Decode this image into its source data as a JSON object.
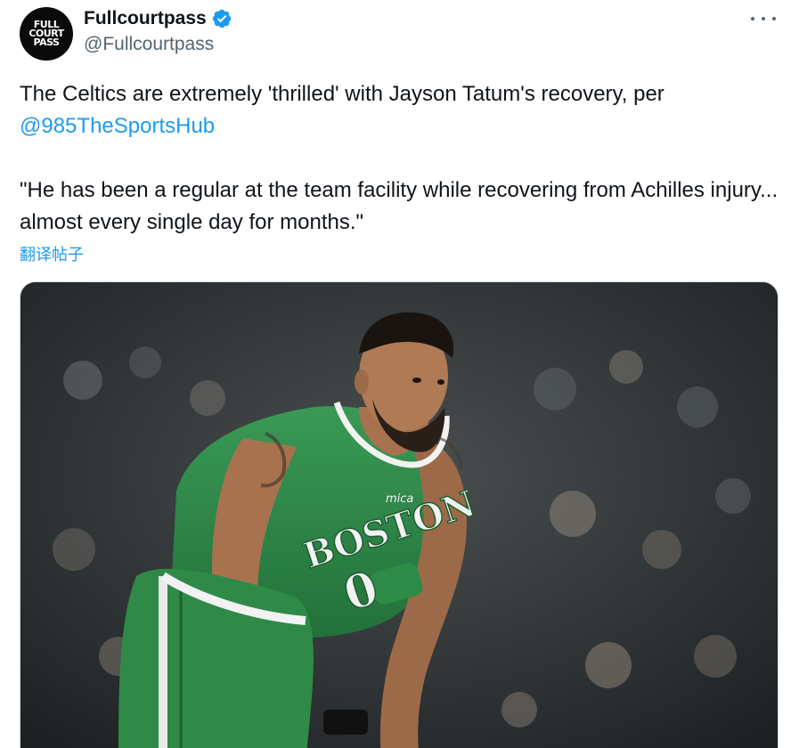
{
  "author": {
    "display_name": "Fullcourtpass",
    "handle": "@Fullcourtpass",
    "verified": true,
    "avatar_icon": "fullcourtpass-logo-icon",
    "avatar_logo_text": [
      "FULL",
      "COURT",
      "PASS"
    ]
  },
  "menu": {
    "icon": "more-horizontal-icon"
  },
  "tweet": {
    "line1_text": "The Celtics are extremely 'thrilled' with Jayson Tatum's recovery, per",
    "mention": "@985TheSportsHub",
    "line3_text": "\"He has been a regular at the team facility while recovering from Achilles injury... almost every single day for months.\"",
    "translate_label": "翻译帖子"
  },
  "media": {
    "type": "photo",
    "jersey_text": "BOSTON",
    "jersey_number": "0",
    "jersey_sponsor": "mica",
    "colors": {
      "jersey": "#2e8b47",
      "jersey_trim": "#f2f2f2",
      "skin": "#b07a55",
      "crowd_bg": "#2b3033"
    }
  },
  "colors": {
    "accent": "#1d9bf0",
    "text_primary": "#0f1419",
    "text_secondary": "#536471",
    "verified_badge": "#1d9bf0"
  }
}
